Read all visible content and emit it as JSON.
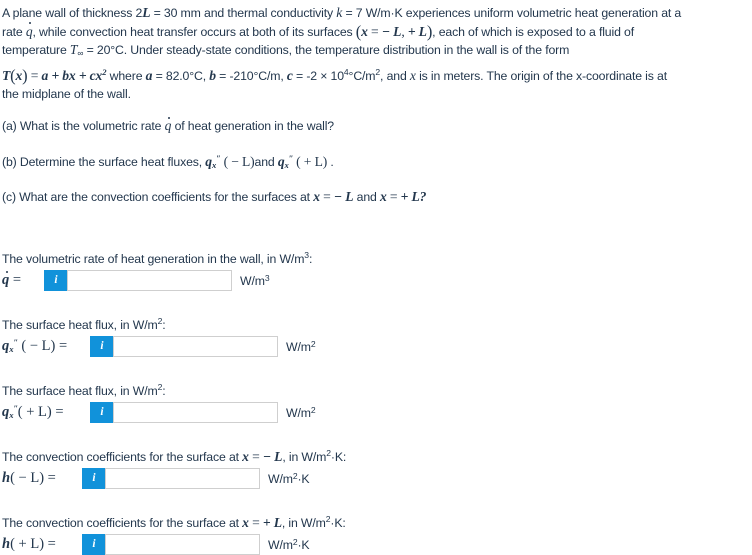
{
  "problem": {
    "line1_a": "A plane wall of thickness 2",
    "sym_2L": "L",
    "line1_b": " =  30 mm and thermal conductivity ",
    "sym_k": "k",
    "line1_c": " =  7 W/m·K experiences uniform volumetric heat generation at a",
    "line2_a": "rate ",
    "sym_qdot": "q",
    "line2_b": ", while convection heat transfer occurs at both of its surfaces ",
    "paren_open": "(",
    "sym_x": "x",
    "eq": " = ",
    "minus_L": " − L",
    "comma": ", ",
    "plus_L": " + L",
    "paren_close": ")",
    "line2_c": ", each of which is exposed to a fluid of",
    "line3_a": "temperature ",
    "sym_T": "T",
    "sub_inf": "∞",
    "line3_b": " =  20°C. Under steady-state conditions, the temperature distribution in the wall is of the form",
    "line4_T": "T",
    "line4_x": "x",
    "line4_eq": " = ",
    "line4_abc": "a + bx + cx",
    "line4_pow": "2",
    "line4_where": " where ",
    "sym_a": "a",
    "val_a": " =  82.0°C, ",
    "sym_b": "b",
    "val_b": " =  -210°C/m, ",
    "sym_c": "c",
    "val_c_pre": " =  -2 × 10",
    "val_c_exp": "4",
    "val_c_post": "°C/m",
    "val_c_post_exp": "2",
    "line4_end": ", and ",
    "sym_x2": "x",
    "line4_end2": " is in meters. The origin of the x-coordinate is at",
    "line5": "the midplane of the wall."
  },
  "parts": {
    "a_pre": "(a) What is the volumetric rate ",
    "a_sym": "q",
    "a_post": " of heat generation in the wall?",
    "b_pre": "(b) Determine the surface heat fluxes, ",
    "b_q1": "q",
    "b_q1_sub": "x",
    "b_q1_sup": "″",
    "b_mid": " ( − L)",
    "b_and": "and ",
    "b_q2": "q",
    "b_q2_sub": "x",
    "b_q2_sup": "″",
    "b_end": " ( + L)",
    "b_period": " .",
    "c_pre": "(c) What are the convection coefficients for the surfaces at ",
    "c_x1": "x",
    "c_eq1": " = ",
    "c_L1": " − L",
    "c_and": " and ",
    "c_x2": "x",
    "c_eq2": " = ",
    "c_L2": " + L",
    "c_q": "?"
  },
  "answers": [
    {
      "name": "qdot",
      "prompt_pre": "The volumetric rate of heat generation in the wall, in W/m",
      "prompt_sup": "3",
      "prompt_post": ":",
      "label_sym": "q",
      "label_post": " = ",
      "info_glyph": "i",
      "value": "",
      "placeholder": "",
      "unit_pre": "W/m",
      "unit_sup": "3",
      "unit_post": "",
      "input_width": 165
    },
    {
      "name": "qx-minus-L",
      "prompt_pre": "The surface heat flux, in W/m",
      "prompt_sup": "2",
      "prompt_post": ":",
      "label_sym": "q",
      "label_sub": "x",
      "label_sup": "″",
      "label_post": " ( − L) = ",
      "info_glyph": "i",
      "value": "",
      "placeholder": "",
      "unit_pre": "W/m",
      "unit_sup": "2",
      "unit_post": "",
      "input_width": 165
    },
    {
      "name": "qx-plus-L",
      "prompt_pre": "The surface heat flux, in W/m",
      "prompt_sup": "2",
      "prompt_post": ":",
      "label_sym": "q",
      "label_sub": "x",
      "label_sup": "″",
      "label_post": "( + L) = ",
      "info_glyph": "i",
      "value": "",
      "placeholder": "",
      "unit_pre": "W/m",
      "unit_sup": "2",
      "unit_post": "",
      "input_width": 165
    },
    {
      "name": "h-minus-L",
      "prompt_pre": "The convection coefficients for the surface at ",
      "prompt_x": "x",
      "prompt_eq": " = ",
      "prompt_L": " − L",
      "prompt_mid": ", in W/m",
      "prompt_sup": "2",
      "prompt_post": "·K:",
      "label_sym": "h",
      "label_post": "( − L) = ",
      "info_glyph": "i",
      "value": "",
      "placeholder": "",
      "unit_pre": "W/m",
      "unit_sup": "2",
      "unit_post": "·K",
      "input_width": 155
    },
    {
      "name": "h-plus-L",
      "prompt_pre": "The convection coefficients for the surface at ",
      "prompt_x": "x",
      "prompt_eq": " = ",
      "prompt_L": " + L",
      "prompt_mid": ", in W/m",
      "prompt_sup": "2",
      "prompt_post": "·K:",
      "label_sym": "h",
      "label_post": "( + L) = ",
      "info_glyph": "i",
      "value": "",
      "placeholder": "",
      "unit_pre": "W/m",
      "unit_sup": "2",
      "unit_post": "·K",
      "input_width": 155
    }
  ],
  "colors": {
    "info_button": "#1192da",
    "text": "#23374d",
    "input_border": "#cfcfcf",
    "background": "#ffffff"
  }
}
